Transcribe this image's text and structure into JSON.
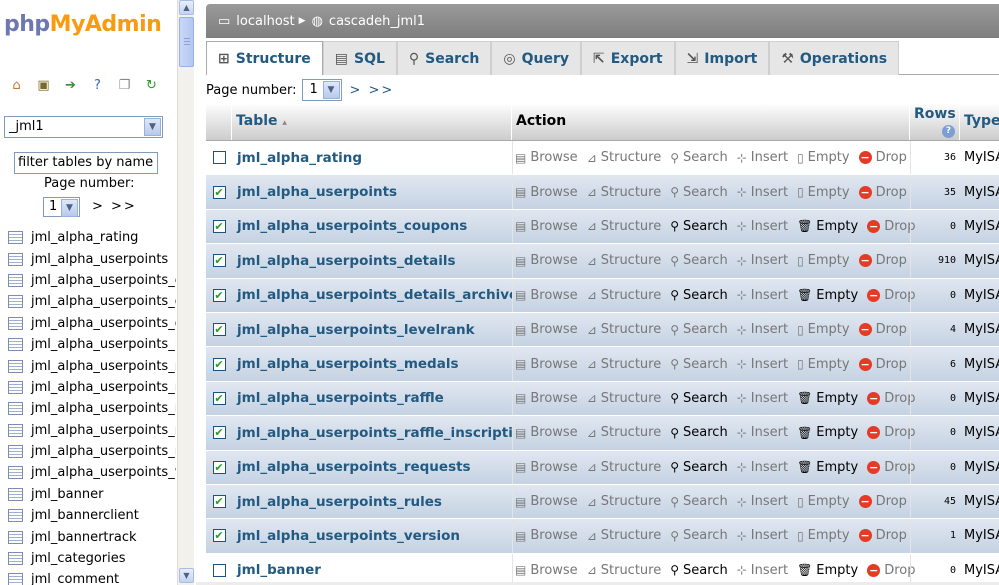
{
  "nav": {
    "logo_php": "php",
    "logo_myadmin": "MyAdmin",
    "icons": [
      "home-icon",
      "exit-icon",
      "query-window-icon",
      "help-icon",
      "docs-icon",
      "reload-icon"
    ],
    "database_selected": "_jml1",
    "filter_placeholder": "filter tables by name",
    "page_label": "Page number:",
    "page_value": "1",
    "page_nav": "> >>",
    "tables": [
      "jml_alpha_rating",
      "jml_alpha_userpoints",
      "jml_alpha_userpoints_coupons",
      "jml_alpha_userpoints_details",
      "jml_alpha_userpoints_details_archive",
      "jml_alpha_userpoints_levelrank",
      "jml_alpha_userpoints_medals",
      "jml_alpha_userpoints_raffle",
      "jml_alpha_userpoints_raffle_inscriptions",
      "jml_alpha_userpoints_requests",
      "jml_alpha_userpoints_rules",
      "jml_alpha_userpoints_version",
      "jml_banner",
      "jml_bannerclient",
      "jml_bannertrack",
      "jml_categories",
      "jml_comment"
    ]
  },
  "breadcrumb": {
    "server": "localhost",
    "database": "cascadeh_jml1"
  },
  "tabs": [
    {
      "label": "Structure",
      "icon": "structure-icon"
    },
    {
      "label": "SQL",
      "icon": "sql-icon"
    },
    {
      "label": "Search",
      "icon": "search-icon"
    },
    {
      "label": "Query",
      "icon": "query-icon"
    },
    {
      "label": "Export",
      "icon": "export-icon"
    },
    {
      "label": "Import",
      "icon": "import-icon"
    },
    {
      "label": "Operations",
      "icon": "operations-icon"
    }
  ],
  "main_page": {
    "label": "Page number:",
    "value": "1",
    "nav": "> >>"
  },
  "table_header": {
    "table": "Table",
    "action": "Action",
    "rows": "Rows",
    "type": "Type"
  },
  "actions": {
    "browse": "Browse",
    "structure": "Structure",
    "search": "Search",
    "insert": "Insert",
    "empty": "Empty",
    "drop": "Drop"
  },
  "rows": [
    {
      "name": "jml_alpha_rating",
      "checked": false,
      "rows": "36",
      "type": "MyISAM",
      "has_data": true
    },
    {
      "name": "jml_alpha_userpoints",
      "checked": true,
      "rows": "35",
      "type": "MyISAM",
      "has_data": true
    },
    {
      "name": "jml_alpha_userpoints_coupons",
      "checked": true,
      "rows": "0",
      "type": "MyISAM",
      "has_data": false
    },
    {
      "name": "jml_alpha_userpoints_details",
      "checked": true,
      "rows": "910",
      "type": "MyISAM",
      "has_data": true
    },
    {
      "name": "jml_alpha_userpoints_details_archive",
      "checked": true,
      "rows": "0",
      "type": "MyISAM",
      "has_data": false
    },
    {
      "name": "jml_alpha_userpoints_levelrank",
      "checked": true,
      "rows": "4",
      "type": "MyISAM",
      "has_data": true
    },
    {
      "name": "jml_alpha_userpoints_medals",
      "checked": true,
      "rows": "6",
      "type": "MyISAM",
      "has_data": true
    },
    {
      "name": "jml_alpha_userpoints_raffle",
      "checked": true,
      "rows": "0",
      "type": "MyISAM",
      "has_data": false
    },
    {
      "name": "jml_alpha_userpoints_raffle_inscriptions",
      "checked": true,
      "rows": "0",
      "type": "MyISAM",
      "has_data": false
    },
    {
      "name": "jml_alpha_userpoints_requests",
      "checked": true,
      "rows": "0",
      "type": "MyISAM",
      "has_data": false
    },
    {
      "name": "jml_alpha_userpoints_rules",
      "checked": true,
      "rows": "45",
      "type": "MyISAM",
      "has_data": true
    },
    {
      "name": "jml_alpha_userpoints_version",
      "checked": true,
      "rows": "1",
      "type": "MyISAM",
      "has_data": true
    },
    {
      "name": "jml_banner",
      "checked": false,
      "rows": "0",
      "type": "MyISAM",
      "has_data": false
    }
  ]
}
